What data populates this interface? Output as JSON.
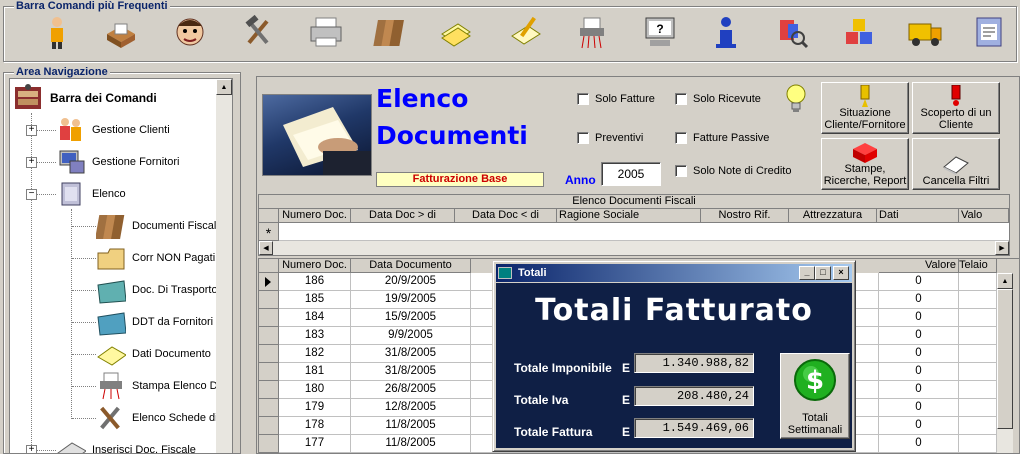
{
  "toolbar": {
    "title": "Barra Comandi più Frequenti",
    "icons": [
      "person-icon",
      "card-file-icon",
      "customer-face-icon",
      "tools-icon",
      "printer-icon",
      "folders-icon",
      "notes-icon",
      "edit-document-icon",
      "shredder-icon",
      "help-monitor-icon",
      "info-icon",
      "search-tools-icon",
      "cubes-icon",
      "truck-icon",
      "book-folder-icon"
    ]
  },
  "nav": {
    "title": "Area Navigazione",
    "root": "Barra dei Comandi",
    "items": [
      {
        "label": "Gestione Clienti",
        "expander": "+"
      },
      {
        "label": "Gestione Fornitori",
        "expander": "+"
      },
      {
        "label": "Elenco",
        "expander": "−"
      },
      {
        "label": "Documenti Fiscali"
      },
      {
        "label": "Corr NON Pagati"
      },
      {
        "label": "Doc. Di Trasporto"
      },
      {
        "label": "DDT da Fornitori"
      },
      {
        "label": "Dati Documento"
      },
      {
        "label": "Stampa Elenco Do"
      },
      {
        "label": "Elenco Schede di L"
      },
      {
        "label": "Inserisci Doc. Fiscale",
        "expander": "+"
      }
    ]
  },
  "header": {
    "title_line1": "Elenco",
    "title_line2": "Documenti",
    "subtitle": "Fatturazione Base",
    "anno_label": "Anno",
    "anno_value": "2005"
  },
  "filters": {
    "solo_fatture": "Solo Fatture",
    "solo_ricevute": "Solo Ricevute",
    "preventivi": "Preventivi",
    "fatture_passive": "Fatture Passive",
    "solo_note_credito": "Solo Note di Credito"
  },
  "buttons": {
    "situazione": "Situazione Cliente/Fornitore",
    "scoperto": "Scoperto di un Cliente",
    "stampe": "Stampe, Ricerche, Report",
    "cancella": "Cancella Filtri"
  },
  "filter_grid": {
    "caption": "Elenco Documenti Fiscali",
    "columns": [
      "Numero Doc.",
      "Data Doc > di",
      "Data Doc < di",
      "Ragione Sociale",
      "Nostro Rif.",
      "Attrezzatura",
      "Dati",
      "Valo"
    ],
    "new_row_marker": "*"
  },
  "data_grid": {
    "columns": [
      "Numero Doc.",
      "Data Documento",
      "Valore",
      "Telaio"
    ],
    "rows": [
      {
        "num": "186",
        "date": "20/9/2005",
        "valore": "0"
      },
      {
        "num": "185",
        "date": "19/9/2005",
        "valore": "0"
      },
      {
        "num": "184",
        "date": "15/9/2005",
        "valore": "0"
      },
      {
        "num": "183",
        "date": "9/9/2005",
        "valore": "0"
      },
      {
        "num": "182",
        "date": "31/8/2005",
        "valore": "0"
      },
      {
        "num": "181",
        "date": "31/8/2005",
        "valore": "0"
      },
      {
        "num": "180",
        "date": "26/8/2005",
        "valore": "0"
      },
      {
        "num": "179",
        "date": "12/8/2005",
        "valore": "0"
      },
      {
        "num": "178",
        "date": "11/8/2005",
        "valore": "0"
      },
      {
        "num": "177",
        "date": "11/8/2005",
        "valore": "0"
      }
    ]
  },
  "dialog": {
    "title": "Totali",
    "heading": "Totali Fatturato",
    "imponibile_label": "Totale Imponibile",
    "iva_label": "Totale Iva",
    "fattura_label": "Totale Fattura",
    "currency": "E",
    "imponibile": "1.340.988,82",
    "iva": "208.480,24",
    "fattura": "1.549.469,06",
    "settimanali": "Totali Settimanali"
  },
  "colors": {
    "accent": "#0a246a",
    "title_blue": "#0000ff",
    "dialog_bg": "#0f1f45",
    "subtitle_red": "#cc0000",
    "subtitle_bg": "#ffffc0"
  }
}
